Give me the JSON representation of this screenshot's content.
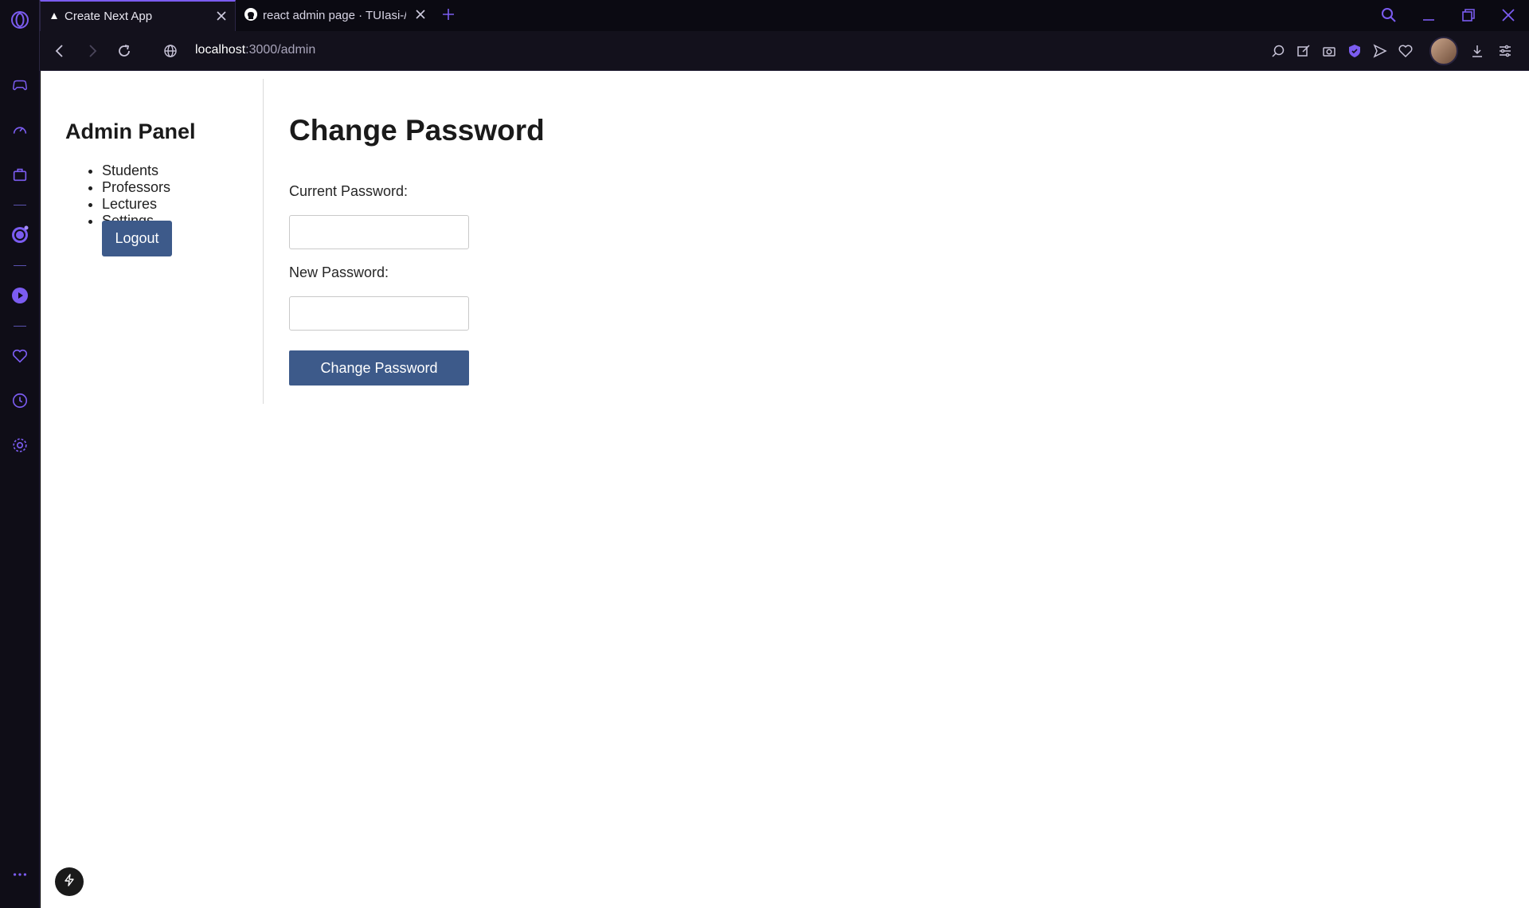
{
  "browser": {
    "tabs": [
      {
        "label": "Create Next App",
        "active": true,
        "icon": "triangle-icon"
      },
      {
        "label": "react admin page · TUIasi-/",
        "active": false,
        "icon": "github-icon"
      }
    ],
    "url_host": "localhost",
    "url_path": ":3000/admin",
    "accent_color": "#7b5cf0"
  },
  "sidebar": {
    "icons": [
      "opera-logo-icon",
      "gamepad-icon",
      "speed-dial-icon",
      "briefcase-icon",
      "whatsapp-icon",
      "music-player-icon",
      "heart-icon",
      "history-icon",
      "settings-icon",
      "more-icon"
    ]
  },
  "admin": {
    "title": "Admin Panel",
    "nav": [
      "Students",
      "Professors",
      "Lectures",
      "Settings"
    ],
    "logout_label": "Logout"
  },
  "form": {
    "heading": "Change Password",
    "current_label": "Current Password:",
    "new_label": "New Password:",
    "current_value": "",
    "new_value": "",
    "submit_label": "Change Password",
    "button_color": "#3d5a8a"
  }
}
